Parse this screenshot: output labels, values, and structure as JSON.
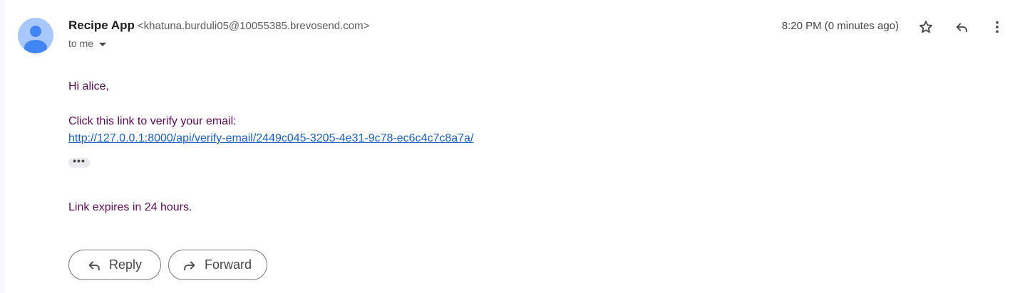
{
  "email": {
    "sender_name": "Recipe App",
    "sender_email": "<khatuna.burduli05@10055385.brevosend.com>",
    "recipient_line": "to me",
    "timestamp": "8:20 PM (0 minutes ago)"
  },
  "body": {
    "greeting": "Hi alice,",
    "instruction": "Click this link to verify your email:",
    "verify_link": "http://127.0.0.1:8000/api/verify-email/2449c045-3205-4e31-9c78-ec6c4c7c8a7a/",
    "ellipsis": "•••",
    "expiry_note": "Link expires in 24 hours."
  },
  "actions": {
    "reply_label": "Reply",
    "forward_label": "Forward"
  },
  "icons": {
    "avatar": "person-avatar-icon",
    "star": "star-icon",
    "reply": "reply-icon",
    "more": "more-vert-icon",
    "forward": "forward-icon",
    "caret": "caret-down-icon"
  },
  "colors": {
    "body_text": "#5b0b52",
    "link": "#1a5fbf",
    "avatar_bg": "#a8c7fa",
    "avatar_fg": "#4285f4"
  }
}
